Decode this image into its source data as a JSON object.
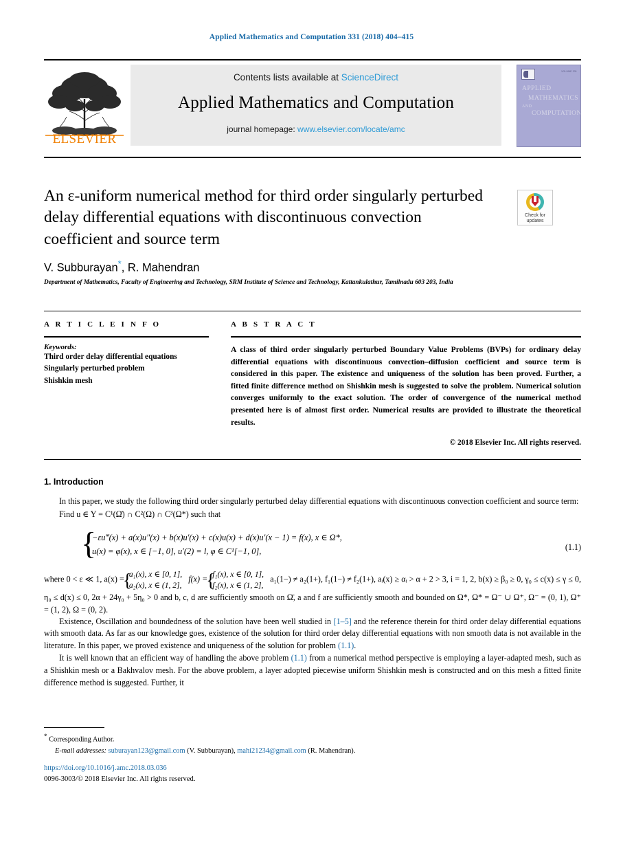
{
  "running_head": "Applied Mathematics and Computation 331 (2018) 404–415",
  "masthead": {
    "publisher_wordmark": "ELSEVIER",
    "contents_prefix": "Contents lists available at ",
    "contents_link": "ScienceDirect",
    "journal_name": "Applied Mathematics and Computation",
    "homepage_prefix": "journal homepage: ",
    "homepage_url": "www.elsevier.com/locate/amc",
    "cover": {
      "issue_note": "VOLUME 331",
      "line1": "APPLIED",
      "line2": "MATHEMATICS",
      "line3": "AND",
      "line4": "COMPUTATION"
    }
  },
  "article": {
    "title": "An ε-uniform numerical method for third order singularly perturbed delay differential equations with discontinuous convection coefficient and source term",
    "authors": "V. Subburayan",
    "authors_star": "*",
    "authors_rest": ", R. Mahendran",
    "affiliation": "Department of Mathematics, Faculty of Engineering and Technology, SRM Institute of Science and Technology, Kattankulathur, Tamilnadu 603 203, India",
    "crossmark_label_line1": "Check for",
    "crossmark_label_line2": "updates"
  },
  "article_info": {
    "heading": "A R T I C L E   I N F O",
    "keywords_title": "Keywords:",
    "keywords": [
      "Third order delay differential equations",
      "Singularly perturbed problem",
      "Shishkin mesh"
    ]
  },
  "abstract": {
    "heading": "A B S T R A C T",
    "text": "A class of third order singularly perturbed Boundary Value Problems (BVPs) for ordinary delay differential equations with discontinuous convection–diffusion coefficient and source term is considered in this paper. The existence and uniqueness of the solution has been proved. Further, a fitted finite difference method on Shishkin mesh is suggested to solve the problem. Numerical solution converges uniformly to the exact solution. The order of convergence of the numerical method presented here is of almost first order. Numerical results are provided to illustrate the theoretical results.",
    "copyright": "© 2018 Elsevier Inc. All rights reserved."
  },
  "body": {
    "section_number_title": "1. Introduction",
    "para1": "In this paper, we study the following third order singularly perturbed delay differential equations with discontinuous convection coefficient and source term:",
    "para2_prefix": "Find ",
    "para2_math": "u ∈ Y = C",
    "para2_full": "Find u ∈ Y = C¹(Ω̄) ∩ C²(Ω) ∩ C³(Ω*) such that",
    "equation": {
      "line1": "−εu‴(x) + a(x)u″(x) + b(x)u′(x) + c(x)u(x) + d(x)u′(x − 1) = f(x),  x ∈ Ω*,",
      "line2": "u(x) = φ(x),  x ∈ [−1, 0],  u′(2) = l,  φ ∈ C¹[−1, 0],",
      "number": "(1.1)"
    },
    "where_lead": "where  0 < ε ≪ 1,  a(x) =",
    "a_case1": "a₁(x),  x ∈ [0, 1],",
    "a_case2": "a₂(x),  x ∈ (1, 2],",
    "f_lead": "f(x) =",
    "f_case1": "f₁(x),  x ∈ [0, 1],",
    "f_case2": "f₂(x),  x ∈ (1, 2],",
    "where_tail": "a₁(1−) ≠ a₂(1+),  f₁(1−) ≠ f₂(1+),  aᵢ(x) ≥ αᵢ > α + 2 > 3,  i = 1, 2,  b(x) ≥ β₀ ≥ 0,  γ₀ ≤ c(x) ≤ γ ≤ 0,  η₀ ≤ d(x) ≤ 0, 2α + 24γ₀ + 5η₀ > 0 and b, c, d are sufficiently smooth on Ω̄, a and f are sufficiently smooth and bounded on Ω*, Ω* = Ω⁻ ∪ Ω⁺, Ω⁻ = (0, 1), Ω⁺ = (1, 2), Ω = (0, 2).",
    "para3_a": "Existence, Oscillation and boundedness of the solution have been well studied in ",
    "para3_ref": "[1–5]",
    "para3_b": " and the reference therein for third order delay differential equations with smooth data. As far as our knowledge goes, existence of the solution for third order delay differential equations with non smooth data is not available in the literature. In this paper, we proved existence and uniqueness of the solution for problem ",
    "para3_ref2": "(1.1)",
    "para3_c": ".",
    "para4_a": "It is well known that an efficient way of handling the above problem ",
    "para4_ref": "(1.1)",
    "para4_b": " from a numerical method perspective is employing a layer-adapted mesh, such as a Shishkin mesh or a Bakhvalov mesh. For the above problem, a layer adopted piecewise uniform Shishkin mesh is constructed and on this mesh a fitted finite difference method is suggested. Further, it"
  },
  "footer": {
    "corresponding_star": "*",
    "corresponding_label": " Corresponding Author.",
    "email_label": "E-mail addresses:",
    "email1": "suburayan123@gmail.com",
    "email1_owner": " (V. Subburayan),",
    "email2": "mahi21234@gmail.com",
    "email2_owner": " (R. Mahendran).",
    "doi": "https://doi.org/10.1016/j.amc.2018.03.036",
    "issn_line": "0096-3003/© 2018 Elsevier Inc. All rights reserved."
  },
  "colors": {
    "link_blue": "#1a6ba8",
    "sciencedirect_blue": "#2e9bd6",
    "elsevier_orange": "#f08000",
    "cover_lavender": "#a9a9d4"
  }
}
